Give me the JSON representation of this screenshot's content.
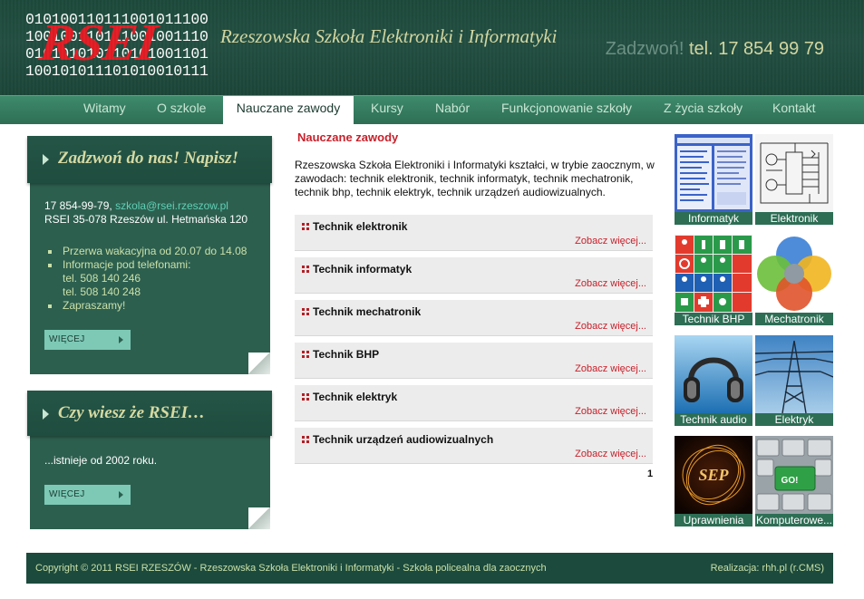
{
  "header": {
    "logo_binary": [
      "010100110111001011100",
      "100100110111001001110",
      "010101010110101001101",
      "100101011101010010111"
    ],
    "logo_word": "RSEI",
    "school_name": "Rzeszowska Szkoła Elektroniki i Informatyki",
    "call_label": "Zadzwoń!",
    "phone": "tel. 17 854 99 79"
  },
  "nav": {
    "items": [
      {
        "label": "Witamy"
      },
      {
        "label": "O szkole"
      },
      {
        "label": "Nauczane zawody"
      },
      {
        "label": "Kursy"
      },
      {
        "label": "Nabór"
      },
      {
        "label": "Funkcjonowanie szkoły"
      },
      {
        "label": "Z życia szkoły"
      },
      {
        "label": "Kontakt"
      }
    ],
    "active": "Nauczane zawody"
  },
  "contact_box": {
    "title": "Zadzwoń do nas! Napisz!",
    "phone": "17 854-99-79,",
    "email": "szkola@rsei.rzeszow.pl",
    "address": "RSEI 35-078 Rzeszów ul. Hetmańska 120",
    "list": [
      "Przerwa wakacyjna od 20.07 do 14.08",
      "Informacje pod telefonami:",
      "tel. 508 140 246",
      "tel. 508 140 248",
      "Zapraszamy!"
    ],
    "more_label": "WIĘCEJ"
  },
  "fact_box": {
    "title": "Czy wiesz że RSEI…",
    "text": "...istnieje od 2002 roku.",
    "more_label": "WIĘCEJ"
  },
  "main": {
    "title": "Nauczane zawody",
    "intro": "Rzeszowska Szkoła Elektroniki i Informatyki kształci, w trybie zaocznym, w zawodach: technik elektronik, technik informatyk, technik mechatronik, technik bhp, technik elektryk, technik urządzeń audiowizualnych.",
    "professions": [
      {
        "name": "Technik elektronik",
        "more": "Zobacz więcej..."
      },
      {
        "name": "Technik informatyk",
        "more": "Zobacz więcej..."
      },
      {
        "name": "Technik mechatronik",
        "more": "Zobacz więcej..."
      },
      {
        "name": "Technik BHP",
        "more": "Zobacz więcej..."
      },
      {
        "name": "Technik elektryk",
        "more": "Zobacz więcej..."
      },
      {
        "name": "Technik urządzeń audiowizualnych",
        "more": "Zobacz więcej..."
      }
    ],
    "page": "1"
  },
  "thumbs": [
    {
      "caption": "Informatyk",
      "icon": "software-screen-icon"
    },
    {
      "caption": "Elektronik",
      "icon": "circuit-diagram-icon"
    },
    {
      "caption": "Technik BHP",
      "icon": "safety-signs-icon"
    },
    {
      "caption": "Mechatronik",
      "icon": "venn-diagram-icon"
    },
    {
      "caption": "Technik audio",
      "icon": "headphones-icon"
    },
    {
      "caption": "Elektryk",
      "icon": "power-pylon-icon"
    },
    {
      "caption": "Uprawnienia",
      "icon": "sep-logo-icon",
      "logo_text": "SEP"
    },
    {
      "caption": "Komputerowe...",
      "icon": "keyboard-icon",
      "key_text": "GO!"
    }
  ],
  "footer": {
    "copyright": "Copyright © 2011 RSEI RZESZÓW - Rzeszowska Szkoła Elektroniki i Informatyki - Szkoła policealna dla zaocznych",
    "credit": "Realizacja: rhh.pl (r.CMS)"
  }
}
